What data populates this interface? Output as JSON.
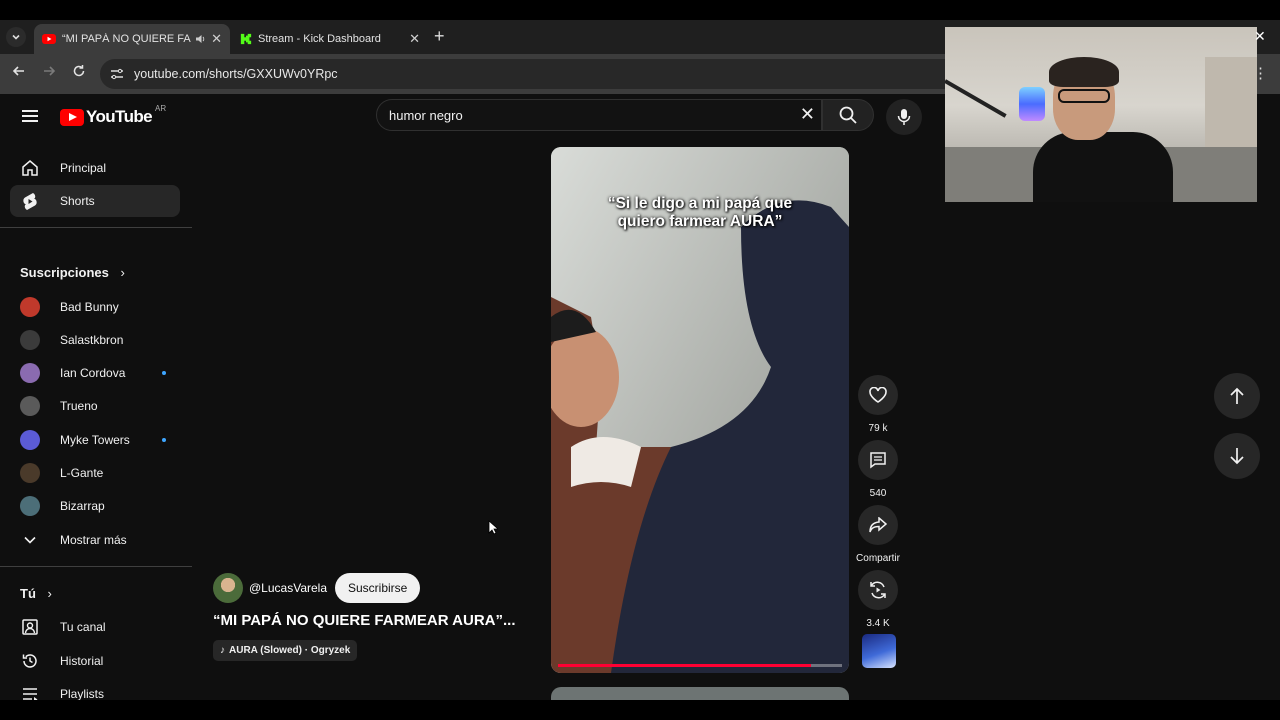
{
  "browser": {
    "tabs": [
      {
        "label": "“MI PAPÁ NO QUIERE FARM",
        "active": true,
        "favicon": "youtube-icon"
      },
      {
        "label": "Stream - Kick Dashboard",
        "active": false,
        "favicon": "kick-icon"
      }
    ],
    "new_tab": "+",
    "url": "youtube.com/shorts/GXXUWv0YRpc"
  },
  "youtube": {
    "logo_text": "YouTube",
    "country_code": "AR",
    "search": {
      "value": "humor negro"
    }
  },
  "sidebar": {
    "main": [
      {
        "label": "Principal",
        "icon": "home-icon"
      },
      {
        "label": "Shorts",
        "icon": "shorts-icon",
        "active": true
      }
    ],
    "subscriptions_header": "Suscripciones",
    "subscriptions": [
      {
        "label": "Bad Bunny",
        "new": false,
        "color": "#c0392b"
      },
      {
        "label": "Salastkbron",
        "new": false,
        "color": "#3b3b3b"
      },
      {
        "label": "Ian Cordova",
        "new": true,
        "color": "#8a6bb0"
      },
      {
        "label": "Trueno",
        "new": false,
        "color": "#5a5a5a"
      },
      {
        "label": "Myke Towers",
        "new": true,
        "color": "#5b5bd6"
      },
      {
        "label": "L-Gante",
        "new": false,
        "color": "#4a3a2a"
      },
      {
        "label": "Bizarrap",
        "new": false,
        "color": "#4c6e78"
      }
    ],
    "show_more": "Mostrar más",
    "you_header": "Tú",
    "you_items": [
      {
        "label": "Tu canal",
        "icon": "channel-icon"
      },
      {
        "label": "Historial",
        "icon": "history-icon"
      },
      {
        "label": "Playlists",
        "icon": "playlists-icon"
      }
    ]
  },
  "short": {
    "caption_line1": "“Si le digo a mi papá que",
    "caption_line2": "quiero farmear AURA”",
    "channel": "@LucasVarela",
    "subscribe_label": "Suscribirse",
    "title": "“MI PAPÁ NO QUIERE FARMEAR AURA”...",
    "music": "AURA (Slowed) · Ogryzek",
    "progress": 0.89,
    "likes": "79 k",
    "comments": "540",
    "share_label": "Compartir",
    "remix_count": "3.4 K"
  },
  "colors": {
    "accent": "#ff0000",
    "progress": "#ff0033",
    "new_dot": "#3ea6ff"
  }
}
